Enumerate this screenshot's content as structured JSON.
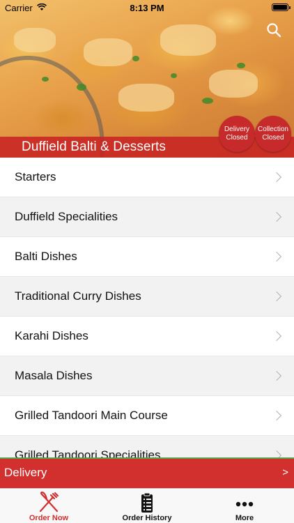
{
  "status_bar": {
    "carrier": "Carrier",
    "time": "8:13 PM"
  },
  "header": {
    "restaurant_name": "Duffield Balti & Desserts",
    "badges": [
      {
        "line1": "Delivery",
        "line2": "Closed"
      },
      {
        "line1": "Collection",
        "line2": "Closed"
      }
    ],
    "search_icon": "search-icon"
  },
  "menu": {
    "items": [
      {
        "label": "Starters"
      },
      {
        "label": "Duffield Specialities"
      },
      {
        "label": "Balti Dishes"
      },
      {
        "label": "Traditional Curry Dishes"
      },
      {
        "label": "Karahi Dishes"
      },
      {
        "label": "Masala Dishes"
      },
      {
        "label": "Grilled Tandoori Main Course"
      },
      {
        "label": "Grilled Tandoori Specialities"
      }
    ]
  },
  "delivery_bar": {
    "label": "Delivery",
    "arrow": ">"
  },
  "tabbar": {
    "tabs": [
      {
        "label": "Order Now",
        "icon": "fork-knife-icon",
        "color": "#d22f2f"
      },
      {
        "label": "Order History",
        "icon": "clipboard-icon",
        "color": "#111111"
      },
      {
        "label": "More",
        "icon": "more-dots-icon",
        "color": "#111111"
      }
    ]
  },
  "colors": {
    "brand_red": "#d22f2f",
    "badge_red": "#c62a2a"
  }
}
